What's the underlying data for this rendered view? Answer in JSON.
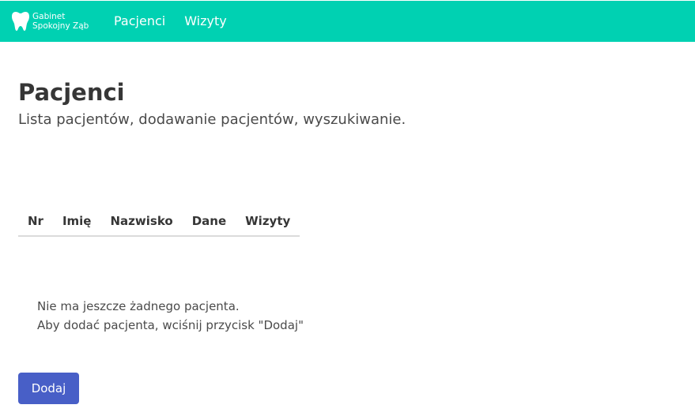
{
  "navbar": {
    "brand": {
      "line1": "Gabinet",
      "line2": "Spokojny Ząb",
      "icon": "tooth-icon"
    },
    "items": [
      {
        "label": "Pacjenci"
      },
      {
        "label": "Wizyty"
      }
    ],
    "color": "#00d1b2"
  },
  "main": {
    "title": "Pacjenci",
    "subtitle": "Lista pacjentów, dodawanie pacjentów, wyszukiwanie.",
    "table": {
      "columns": [
        "Nr",
        "Imię",
        "Nazwisko",
        "Dane",
        "Wizyty"
      ],
      "rows": []
    },
    "empty_state": {
      "line1": "Nie ma jeszcze żadnego pacjenta.",
      "line2": "Aby dodać pacjenta, wciśnij przycisk \"Dodaj\""
    },
    "add_button": {
      "label": "Dodaj",
      "color": "#485fc7"
    }
  }
}
